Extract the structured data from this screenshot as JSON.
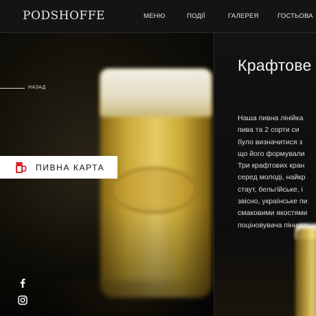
{
  "header": {
    "logo": "PODSHOFFE",
    "nav": [
      {
        "label": "МЕНЮ"
      },
      {
        "label": "ПОДІЇ"
      },
      {
        "label": "ГАЛЕРЕЯ"
      },
      {
        "label": "ГОСТЬОВА"
      }
    ]
  },
  "sidebar": {
    "back_label": "НАЗАД",
    "beer_card_label": "ПИВНА КАРТА",
    "beer_card_icon": "beer-mug-icon",
    "social": [
      {
        "icon": "facebook-icon"
      },
      {
        "icon": "instagram-icon"
      }
    ]
  },
  "content": {
    "title": "Крафтове",
    "lines": [
      "Наша пивна лінійка",
      "пива та 2 сорти си",
      "було визначитися з",
      "що його формували",
      "Три крафтових кран",
      "серед молоді, найкр",
      "стаут, бельгійське, і",
      "звісно, українське пи",
      "смаковими якостями",
      "поціновувача пінного"
    ]
  },
  "colors": {
    "header_bg": "#141414",
    "page_bg": "#0b0b0b",
    "button_bg": "#ffffff",
    "mug_red": "#d7262b"
  }
}
